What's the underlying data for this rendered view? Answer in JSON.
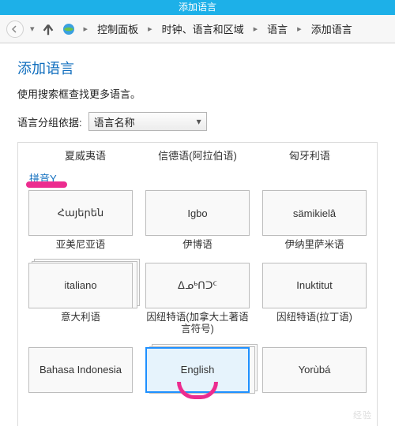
{
  "titlebar": {
    "text": "添加语言"
  },
  "nav": {
    "back_icon": "back",
    "up_icon": "up",
    "cp_icon": "region-globe"
  },
  "breadcrumb": {
    "items": [
      "控制面板",
      "时钟、语言和区域",
      "语言",
      "添加语言"
    ]
  },
  "page": {
    "title": "添加语言",
    "help": "使用搜索框查找更多语言。",
    "group_label": "语言分组依据:",
    "group_value": "语言名称"
  },
  "prev_row": [
    "夏威夷语",
    "信德语(阿拉伯语)",
    "匈牙利语"
  ],
  "section": {
    "head": "拼音Y"
  },
  "tiles": [
    {
      "native": "Հայերեն",
      "caption": "亚美尼亚语",
      "stack": false
    },
    {
      "native": "Igbo",
      "caption": "伊博语",
      "stack": false
    },
    {
      "native": "sämikielâ",
      "caption": "伊纳里萨米语",
      "stack": false
    },
    {
      "native": "italiano",
      "caption": "意大利语",
      "stack": true
    },
    {
      "native": "ᐃᓄᒃᑎᑐᑦ",
      "caption": "因纽特语(加拿大土著语言符号)",
      "stack": false
    },
    {
      "native": "Inuktitut",
      "caption": "因纽特语(拉丁语)",
      "stack": false
    },
    {
      "native": "Bahasa Indonesia",
      "caption": "",
      "stack": false
    },
    {
      "native": "English",
      "caption": "",
      "stack": true,
      "selected": true,
      "circled": true
    },
    {
      "native": "Yorùbá",
      "caption": "",
      "stack": false
    }
  ],
  "watermark": "经验"
}
